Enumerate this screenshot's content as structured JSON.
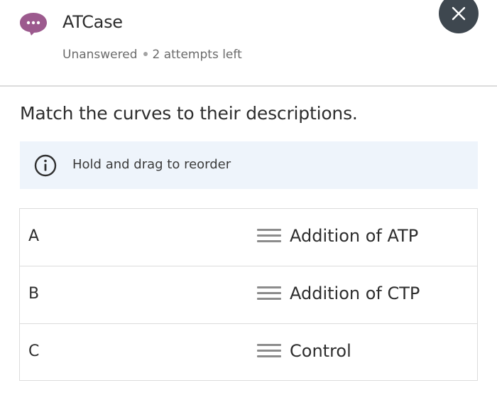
{
  "header": {
    "icon": "chat-bubble-icon",
    "title": "ATCase",
    "status": "Unanswered",
    "attempts": "2 attempts left",
    "close_icon": "close-icon"
  },
  "colors": {
    "chat_icon": "#9c5a8e",
    "close_button": "#3e474f",
    "info_background": "#eef4fb"
  },
  "question": {
    "prompt": "Match the curves to their descriptions."
  },
  "info": {
    "icon": "info-icon",
    "text": "Hold and drag to reorder"
  },
  "matches": {
    "rows": [
      {
        "label": "A",
        "answer": "Addition of ATP"
      },
      {
        "label": "B",
        "answer": "Addition of CTP"
      },
      {
        "label": "C",
        "answer": "Control"
      }
    ]
  }
}
